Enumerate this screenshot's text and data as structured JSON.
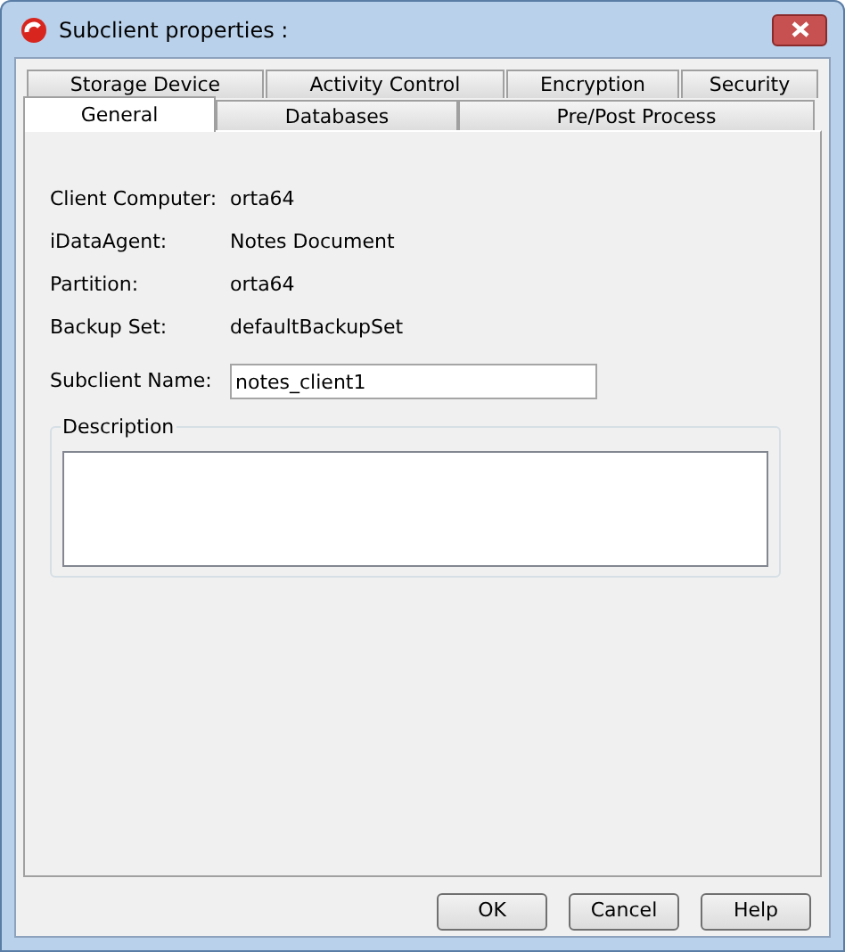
{
  "window": {
    "title": "Subclient properties :"
  },
  "tab_rows": [
    {
      "tabs": [
        {
          "label": "Storage Device",
          "selected": false
        },
        {
          "label": "Activity Control",
          "selected": false
        },
        {
          "label": "Encryption",
          "selected": false
        },
        {
          "label": "Security",
          "selected": false
        }
      ]
    },
    {
      "tabs": [
        {
          "label": "General",
          "selected": true
        },
        {
          "label": "Databases",
          "selected": false
        },
        {
          "label": "Pre/Post Process",
          "selected": false
        }
      ]
    }
  ],
  "fields": [
    {
      "kind": "text",
      "label": "Client Computer:",
      "value": "orta64"
    },
    {
      "kind": "text",
      "label": "iDataAgent:",
      "value": "Notes Document"
    },
    {
      "kind": "text",
      "label": "Partition:",
      "value": "orta64"
    },
    {
      "kind": "text",
      "label": "Backup Set:",
      "value": "defaultBackupSet"
    },
    {
      "kind": "input",
      "label": "Subclient Name:",
      "value": "notes_client1"
    }
  ],
  "description": {
    "label": "Description"
  },
  "buttons": [
    "OK",
    "Cancel",
    "Help"
  ]
}
